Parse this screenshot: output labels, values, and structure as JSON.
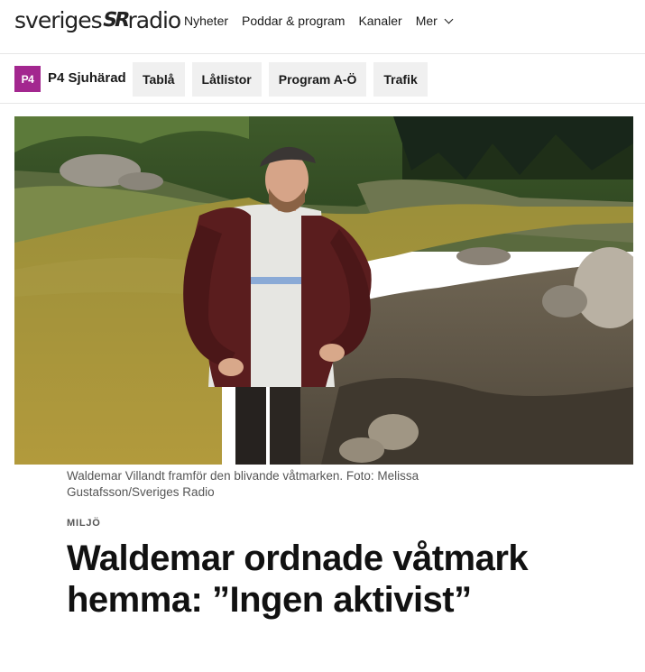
{
  "site": {
    "logo_left": "sveriges",
    "logo_mark": "SR",
    "logo_right": "radio",
    "nav": [
      "Nyheter",
      "Poddar & program",
      "Kanaler"
    ],
    "nav_more": "Mer"
  },
  "channel": {
    "badge": "P4",
    "name": "P4 Sjuhärad",
    "badge_color": "#a3278f",
    "tabs": [
      "Tablå",
      "Låtlistor",
      "Program A-Ö",
      "Trafik"
    ]
  },
  "article": {
    "caption": "Waldemar Villandt framför den blivande våtmarken. Foto: Melissa Gustafsson/Sveriges Radio",
    "category": "MILJÖ",
    "headline": "Waldemar ordnade våtmark hemma: ”Ingen aktivist”"
  }
}
